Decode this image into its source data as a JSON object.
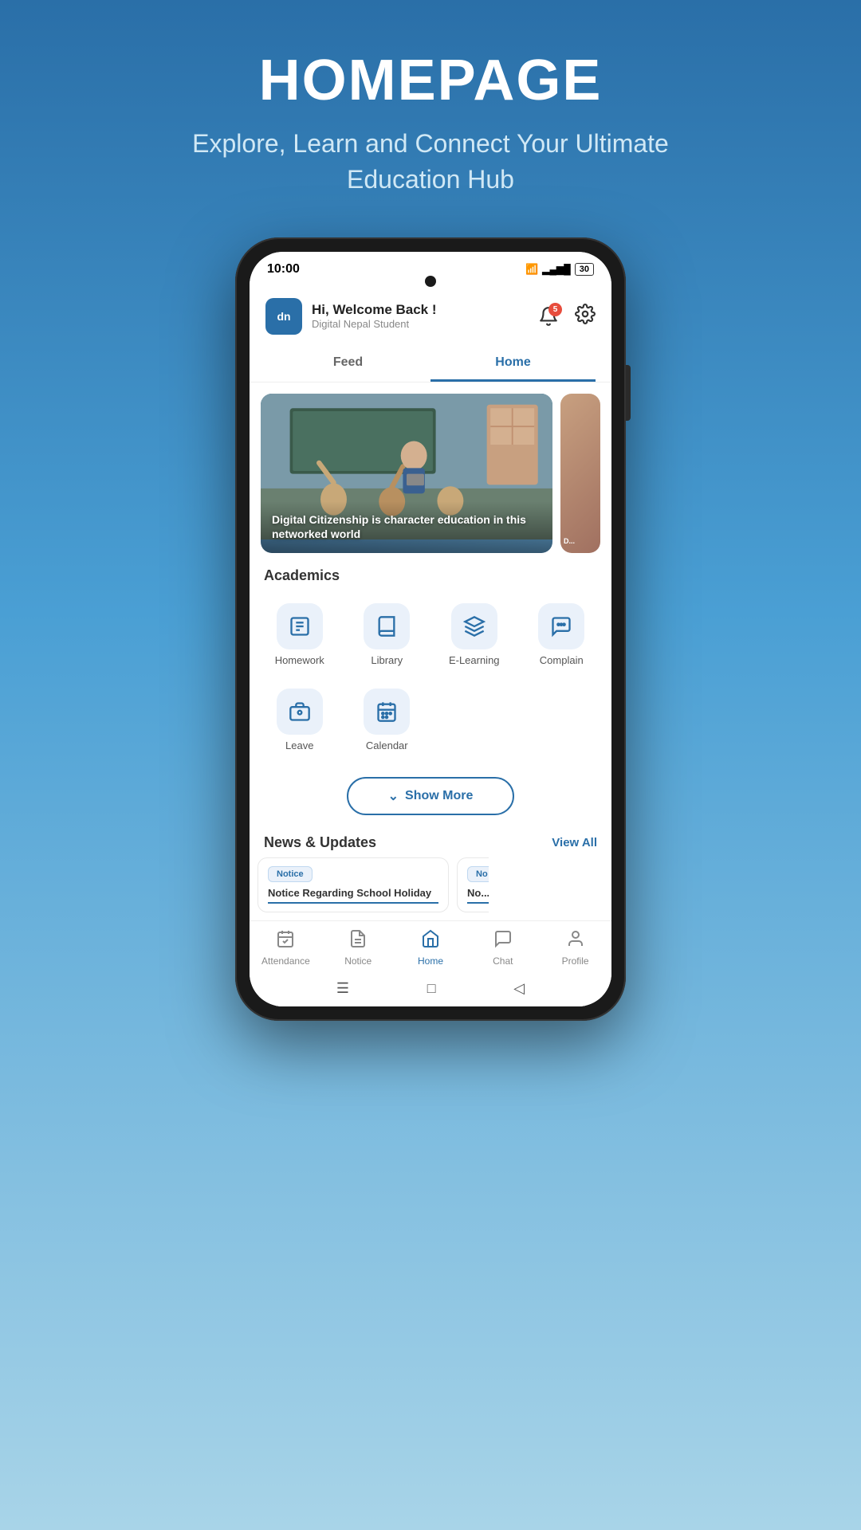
{
  "page": {
    "title": "HOMEPAGE",
    "subtitle": "Explore, Learn and Connect Your Ultimate Education Hub"
  },
  "status_bar": {
    "time": "10:00",
    "badge_count": "5"
  },
  "header": {
    "logo": "dn",
    "welcome": "Hi, Welcome Back !",
    "username": "Digital Nepal Student"
  },
  "tabs": [
    {
      "id": "feed",
      "label": "Feed",
      "active": false
    },
    {
      "id": "home",
      "label": "Home",
      "active": true
    }
  ],
  "banner": {
    "caption": "Digital Citizenship is character education in this networked world"
  },
  "academics": {
    "section_label": "Academics",
    "items": [
      {
        "id": "homework",
        "label": "Homework",
        "icon": "📋"
      },
      {
        "id": "library",
        "label": "Library",
        "icon": "📚"
      },
      {
        "id": "elearning",
        "label": "E-Learning",
        "icon": "🎓"
      },
      {
        "id": "complain",
        "label": "Complain",
        "icon": "💬"
      },
      {
        "id": "leave",
        "label": "Leave",
        "icon": "🧳"
      },
      {
        "id": "calendar",
        "label": "Calendar",
        "icon": "📅"
      }
    ],
    "show_more": "Show More"
  },
  "news": {
    "section_label": "News & Updates",
    "view_all": "View All",
    "items": [
      {
        "tag": "Notice",
        "title": "Notice Regarding School Holiday"
      },
      {
        "tag": "No",
        "title": "No..."
      }
    ]
  },
  "bottom_nav": [
    {
      "id": "attendance",
      "label": "Attendance",
      "icon": "📊",
      "active": false
    },
    {
      "id": "notice",
      "label": "Notice",
      "icon": "📄",
      "active": false
    },
    {
      "id": "home",
      "label": "Home",
      "icon": "🏠",
      "active": true
    },
    {
      "id": "chat",
      "label": "Chat",
      "icon": "💬",
      "active": false
    },
    {
      "id": "profile",
      "label": "Profile",
      "icon": "👤",
      "active": false
    }
  ],
  "android_nav": [
    "☰",
    "□",
    "◁"
  ]
}
